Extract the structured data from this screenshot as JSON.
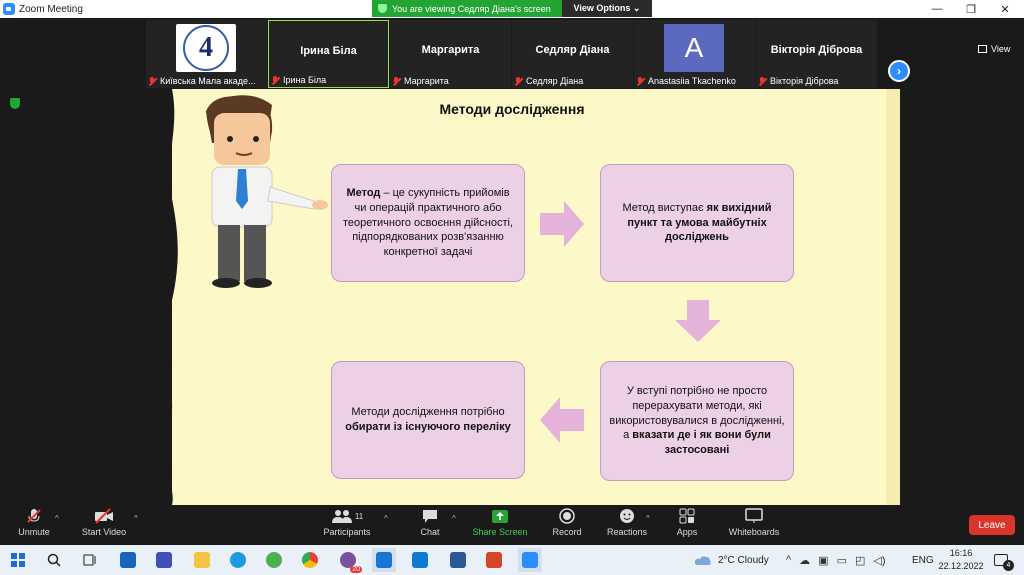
{
  "window": {
    "title": "Zoom Meeting",
    "controls": {
      "minimize": "—",
      "restore": "❐",
      "close": "✕"
    }
  },
  "banner": {
    "viewing_text": "You are viewing Седляр Діана's screen",
    "view_options": "View Options ⌄"
  },
  "participants_strip": [
    {
      "name": "Київська Мала акаде...",
      "type": "logo",
      "logo_text": "4"
    },
    {
      "name": "Ірина Біла",
      "center": "Ірина Біла",
      "active": true
    },
    {
      "name": "Маргарита",
      "center": "Маргарита"
    },
    {
      "name": "Седляр Діана",
      "center": "Седляр Діана"
    },
    {
      "name": "Anastasiia Tkachenko",
      "type": "avatar",
      "initial": "A"
    },
    {
      "name": "Вікторія Діброва",
      "center": "Вікторія Діброва"
    }
  ],
  "view_button": "View",
  "slide": {
    "title": "Методи дослідження",
    "box1_bold": "Метод",
    "box1_text": " – це сукупність прийомів чи операцій практичного або теоретичного освоєння дійсності, підпорядкованих розв'язанню конкретної задачі",
    "box2_pre": "Метод виступає ",
    "box2_bold": "як вихідний пункт та умова майбутніх досліджень",
    "box3_pre": "У вступі потрібно не просто перерахувати методи, які використовувалися в дослідженні, а ",
    "box3_bold": "вказати де і як вони були застосовані",
    "box4_pre": "Методи дослідження потрібно ",
    "box4_bold": "обирати із існуючого переліку",
    "colors": {
      "box_fill": "#ecd0e6",
      "arrow": "#e5b3d9",
      "background": "#fdf8c8"
    }
  },
  "toolbar": {
    "unmute": "Unmute",
    "start_video": "Start Video",
    "participants": "Participants",
    "participants_count": "11",
    "chat": "Chat",
    "share_screen": "Share Screen",
    "record": "Record",
    "reactions": "Reactions",
    "apps": "Apps",
    "whiteboards": "Whiteboards",
    "leave": "Leave"
  },
  "taskbar": {
    "weather": "2°C  Cloudy",
    "lang": "ENG",
    "time": "16:16",
    "date": "22.12.2022",
    "notifications": "4",
    "viber_badge": "20"
  }
}
